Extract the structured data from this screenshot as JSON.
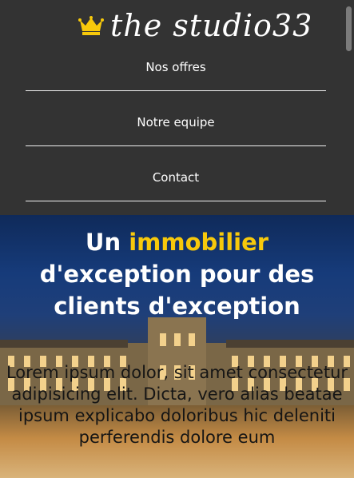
{
  "brand": {
    "name": "the studio33",
    "icon": "crown-icon",
    "icon_color": "#f7c90b"
  },
  "nav": {
    "items": [
      {
        "label": "Nos offres"
      },
      {
        "label": "Notre equipe"
      },
      {
        "label": "Contact"
      }
    ]
  },
  "hero": {
    "title_line1_prefix": "Un ",
    "title_line1_accent": "immobilier",
    "title_line2": "d'exception pour des",
    "title_line3": "clients d'exception",
    "accent_color": "#f7c90b",
    "body": "Lorem ipsum dolor, sit amet consectetur adipisicing elit. Dicta, vero alias beatae ipsum explicabo doloribus hic deleniti perferendis dolore eum"
  },
  "colors": {
    "header_bg": "#333333",
    "text": "#ffffff"
  }
}
